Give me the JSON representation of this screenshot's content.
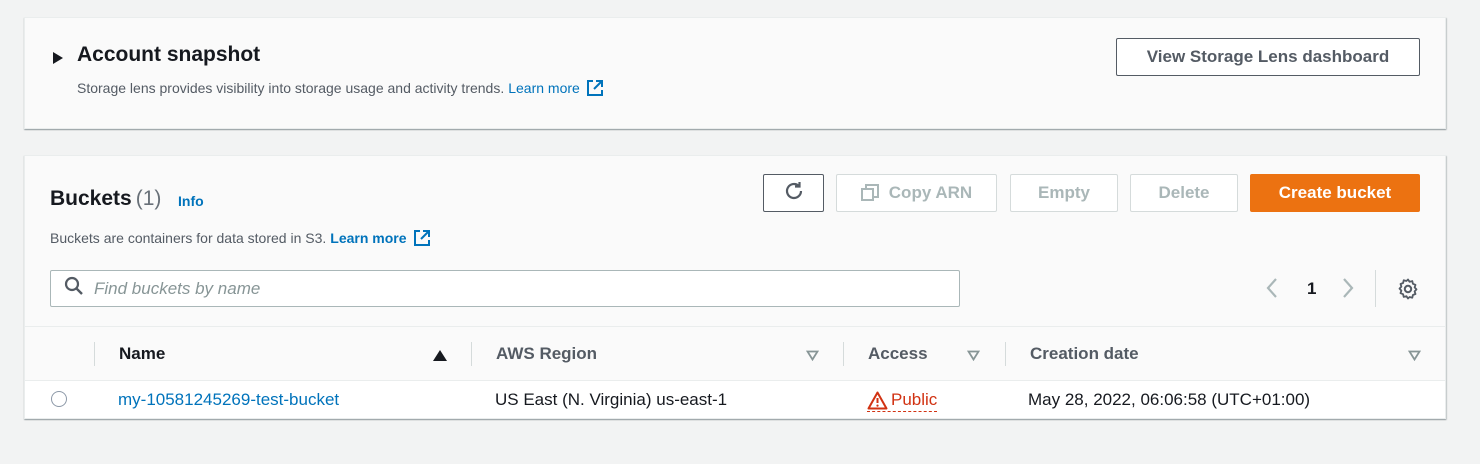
{
  "snapshot": {
    "title": "Account snapshot",
    "description": "Storage lens provides visibility into storage usage and activity trends.",
    "learn_more": "Learn more",
    "dashboard_button": "View Storage Lens dashboard"
  },
  "buckets": {
    "title": "Buckets",
    "count": "(1)",
    "info": "Info",
    "description": "Buckets are containers for data stored in S3.",
    "learn_more": "Learn more",
    "actions": {
      "copy_arn": "Copy ARN",
      "empty": "Empty",
      "delete": "Delete",
      "create": "Create bucket"
    },
    "search": {
      "placeholder": "Find buckets by name",
      "value": ""
    },
    "pagination": {
      "current_page": "1"
    },
    "columns": [
      "Name",
      "AWS Region",
      "Access",
      "Creation date"
    ],
    "rows": [
      {
        "name": "my-10581245269-test-bucket",
        "region": "US East (N. Virginia) us-east-1",
        "access": "Public",
        "created": "May 28, 2022, 06:06:58 (UTC+01:00)"
      }
    ]
  },
  "colors": {
    "primary": "#ec7211",
    "link": "#0073bb",
    "warning": "#d13212"
  }
}
